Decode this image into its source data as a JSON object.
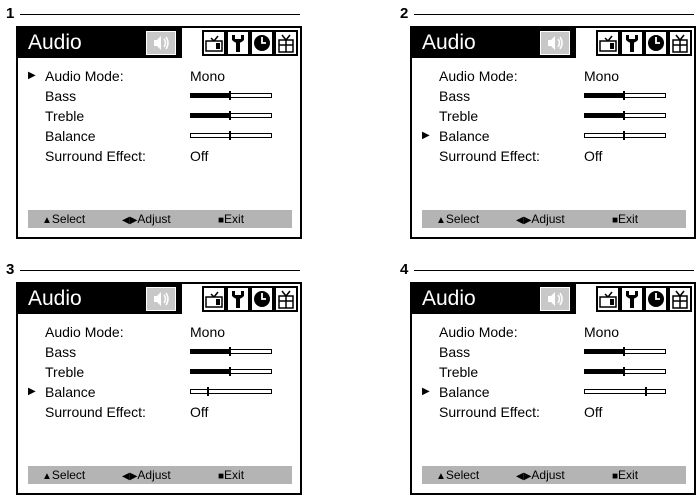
{
  "panels": [
    {
      "number": "1",
      "title": "Audio",
      "selected_item": "audio_mode",
      "items": {
        "audio_mode": {
          "label": "Audio Mode:",
          "value": "Mono"
        },
        "bass": {
          "label": "Bass",
          "level": 0.5
        },
        "treble": {
          "label": "Treble",
          "level": 0.5
        },
        "balance": {
          "label": "Balance",
          "level": 0.5
        },
        "surround": {
          "label": "Surround Effect:",
          "value": "Off"
        }
      },
      "status": {
        "select": "Select",
        "adjust": "Adjust",
        "exit": "Exit"
      }
    },
    {
      "number": "2",
      "title": "Audio",
      "selected_item": "balance",
      "items": {
        "audio_mode": {
          "label": "Audio Mode:",
          "value": "Mono"
        },
        "bass": {
          "label": "Bass",
          "level": 0.5
        },
        "treble": {
          "label": "Treble",
          "level": 0.5
        },
        "balance": {
          "label": "Balance",
          "level": 0.5
        },
        "surround": {
          "label": "Surround Effect:",
          "value": "Off"
        }
      },
      "status": {
        "select": "Select",
        "adjust": "Adjust",
        "exit": "Exit"
      }
    },
    {
      "number": "3",
      "title": "Audio",
      "selected_item": "balance",
      "items": {
        "audio_mode": {
          "label": "Audio Mode:",
          "value": "Mono"
        },
        "bass": {
          "label": "Bass",
          "level": 0.5
        },
        "treble": {
          "label": "Treble",
          "level": 0.5
        },
        "balance": {
          "label": "Balance",
          "level": 0.22
        },
        "surround": {
          "label": "Surround Effect:",
          "value": "Off"
        }
      },
      "status": {
        "select": "Select",
        "adjust": "Adjust",
        "exit": "Exit"
      }
    },
    {
      "number": "4",
      "title": "Audio",
      "selected_item": "balance",
      "items": {
        "audio_mode": {
          "label": "Audio Mode:",
          "value": "Mono"
        },
        "bass": {
          "label": "Bass",
          "level": 0.5
        },
        "treble": {
          "label": "Treble",
          "level": 0.5
        },
        "balance": {
          "label": "Balance",
          "level": 0.78
        },
        "surround": {
          "label": "Surround Effect:",
          "value": "Off"
        }
      },
      "status": {
        "select": "Select",
        "adjust": "Adjust",
        "exit": "Exit"
      }
    }
  ],
  "icons": {
    "audio_tab": "speaker-icon",
    "tabs": [
      "tv-icon",
      "tool-icon",
      "clock-icon",
      "gift-icon"
    ]
  },
  "colors": {
    "title_bar": "#000000",
    "audio_tab": "#c8c8c8",
    "status_bar": "#b4b4b4"
  }
}
